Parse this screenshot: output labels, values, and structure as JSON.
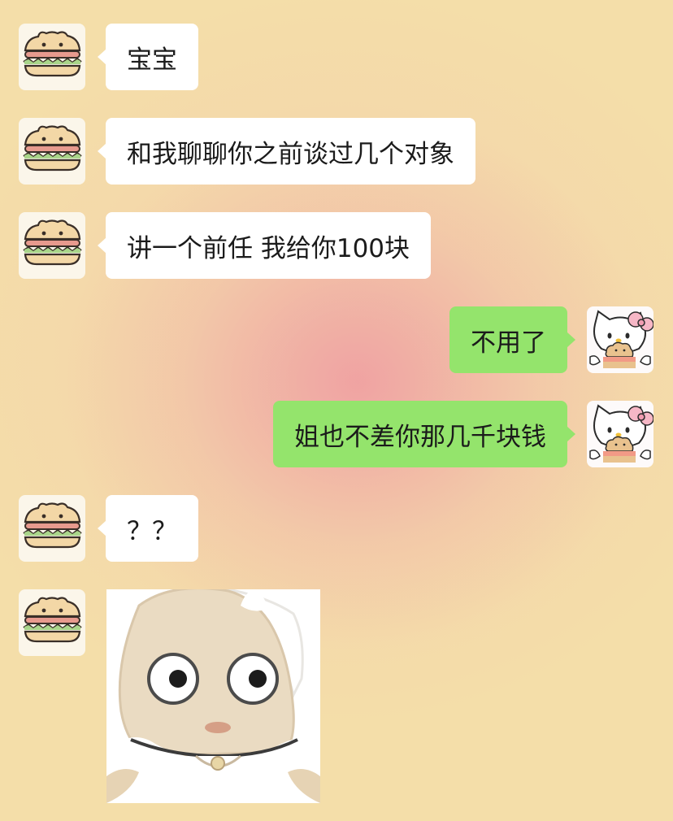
{
  "chat": {
    "messages": [
      {
        "side": "in",
        "type": "text",
        "text": "宝宝"
      },
      {
        "side": "in",
        "type": "text",
        "text": "和我聊聊你之前谈过几个对象"
      },
      {
        "side": "in",
        "type": "text",
        "text": "讲一个前任 我给你100块"
      },
      {
        "side": "out",
        "type": "text",
        "text": "不用了"
      },
      {
        "side": "out",
        "type": "text",
        "text": "姐也不差你那几千块钱"
      },
      {
        "side": "in",
        "type": "text",
        "text": "？？"
      },
      {
        "side": "in",
        "type": "sticker",
        "sticker": "staring-baby-sticker"
      }
    ]
  },
  "avatars": {
    "incoming": "hamburger-bear-avatar",
    "outgoing": "hello-kitty-avatar"
  },
  "colors": {
    "incoming_bubble": "#ffffff",
    "outgoing_bubble": "#94e46c",
    "background": "#f4dea9"
  }
}
